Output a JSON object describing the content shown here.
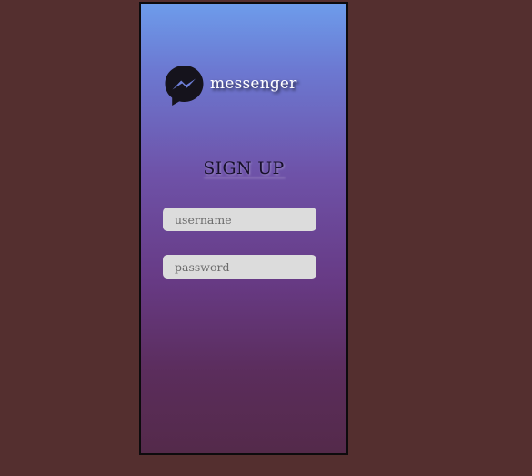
{
  "app": {
    "brand": "messenger",
    "brand_icon": "messenger-bolt-icon"
  },
  "form": {
    "title": "SIGN UP",
    "username": {
      "value": "",
      "placeholder": "username"
    },
    "password": {
      "value": "",
      "placeholder": "password"
    }
  },
  "colors": {
    "page_background": "#542f2f",
    "gradient_top": "#6d9ceb",
    "gradient_bottom": "#542a4a",
    "input_background": "#dcdcdc",
    "title_color": "#17102a",
    "icon_color": "#15131c"
  }
}
